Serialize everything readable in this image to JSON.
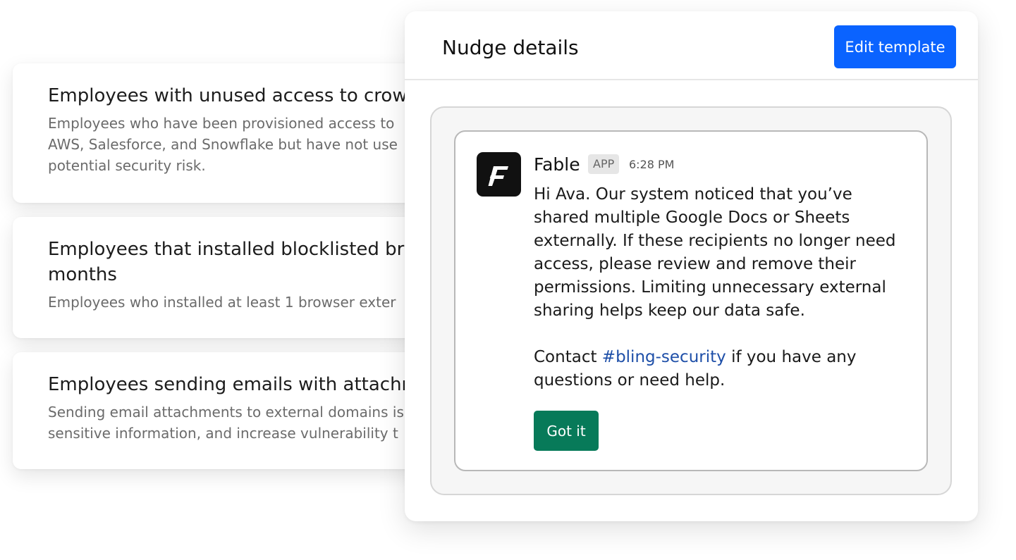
{
  "policies": [
    {
      "title": "Employees with unused access to crow",
      "description_lines": [
        "Employees who  have been provisioned access to",
        "AWS, Salesforce, and Snowflake but have not use",
        "potential security risk."
      ]
    },
    {
      "title_lines": [
        "Employees that installed blocklisted br",
        "months"
      ],
      "description_lines": [
        "Employees who installed at least 1 browser exter"
      ]
    },
    {
      "title": "Employees sending emails with attachr",
      "description_lines": [
        "Sending email attachments to external domains is",
        "sensitive information, and increase vulnerability t"
      ]
    }
  ],
  "panel": {
    "title": "Nudge details",
    "edit_button_label": "Edit template",
    "edit_button_color": "#0a63ff"
  },
  "message": {
    "avatar_icon": "fable-logo-icon",
    "sender": "Fable",
    "badge": "APP",
    "time": "6:28 PM",
    "paragraph1_lines": [
      "Hi Ava. Our system noticed that you’ve",
      "shared multiple Google Docs or Sheets",
      "externally. If these recipients no longer need",
      "access, please review and remove their",
      "permissions. Limiting unnecessary external",
      "sharing helps keep our data safe."
    ],
    "contact_prefix": "Contact ",
    "channel": "#bling-security",
    "contact_suffix": " if you have any",
    "contact_line2": "questions or need help.",
    "button_label": "Got it",
    "button_color": "#077a59",
    "link_color": "#1e4fa8"
  }
}
